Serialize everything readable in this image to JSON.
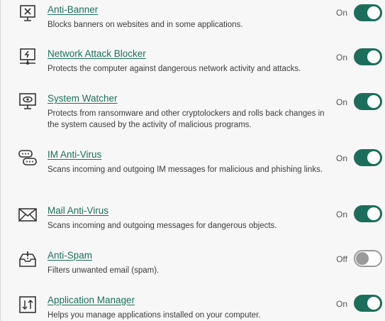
{
  "components": [
    {
      "key": "anti-banner",
      "title": "Anti-Banner",
      "description": "Blocks banners on websites and in some applications.",
      "state": "On",
      "enabled": true,
      "icon": "banner-block-icon"
    },
    {
      "key": "network-attack-blocker",
      "title": "Network Attack Blocker",
      "description": "Protects the computer against dangerous network activity and attacks.",
      "state": "On",
      "enabled": true,
      "icon": "network-monitor-icon"
    },
    {
      "key": "system-watcher",
      "title": "System Watcher",
      "description": "Protects from ransomware and other cryptolockers and rolls back changes in the system caused by the activity of malicious programs.",
      "state": "On",
      "enabled": true,
      "icon": "monitor-eye-icon"
    },
    {
      "key": "im-anti-virus",
      "title": "IM Anti-Virus",
      "description": "Scans incoming and outgoing IM messages for malicious and phishing links.",
      "state": "On",
      "enabled": true,
      "icon": "chat-bubbles-icon"
    },
    {
      "key": "mail-anti-virus",
      "title": "Mail Anti-Virus",
      "description": "Scans incoming and outgoing messages for dangerous objects.",
      "state": "On",
      "enabled": true,
      "icon": "envelope-icon"
    },
    {
      "key": "anti-spam",
      "title": "Anti-Spam",
      "description": "Filters unwanted email (spam).",
      "state": "Off",
      "enabled": false,
      "icon": "inbox-alert-icon"
    },
    {
      "key": "application-manager",
      "title": "Application Manager",
      "description": "Helps you manage applications installed on your computer.",
      "state": "On",
      "enabled": true,
      "icon": "app-manager-icon"
    }
  ]
}
